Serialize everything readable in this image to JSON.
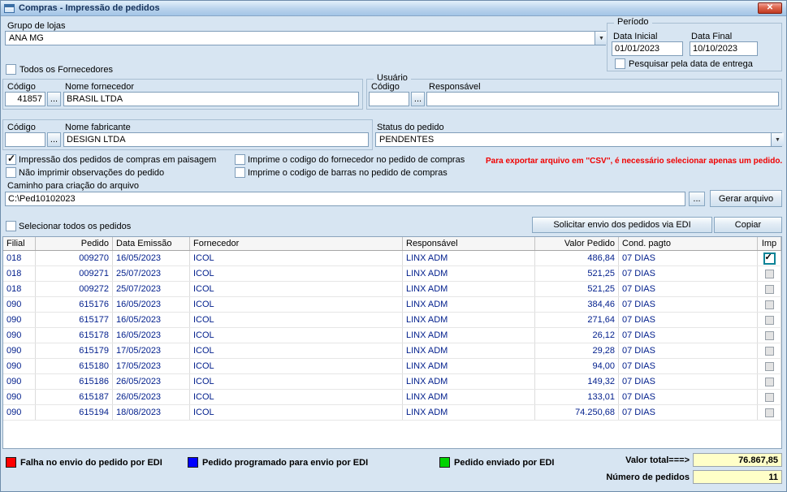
{
  "window": {
    "title": "Compras - Impressão de pedidos"
  },
  "icons": {
    "close": "✕",
    "dropdown": "▼"
  },
  "ui": {
    "browse_label": "..."
  },
  "top": {
    "grupo_lojas_label": "Grupo de lojas",
    "grupo_lojas_value": "ANA MG"
  },
  "periodo": {
    "title": "Período",
    "data_inicial_label": "Data Inicial",
    "data_inicial_value": "01/01/2023",
    "data_final_label": "Data Final",
    "data_final_value": "10/10/2023"
  },
  "checkboxes": {
    "pesquisar_entrega": {
      "label": "Pesquisar pela data de entrega",
      "checked": false
    },
    "todos_fornecedores": {
      "label": "Todos os Fornecedores",
      "checked": false
    },
    "paisagem": {
      "label": "Impressão dos pedidos de compras em paisagem",
      "checked": true
    },
    "nao_imprimir_obs": {
      "label": "Não imprimir observações do pedido",
      "checked": false
    },
    "imprime_cod_fornecedor": {
      "label": "Imprime o codigo do fornecedor no pedido de compras",
      "checked": false
    },
    "imprime_cod_barras": {
      "label": "Imprime o codigo de barras no pedido de compras",
      "checked": false
    },
    "selecionar_todos": {
      "label": "Selecionar todos os pedidos",
      "checked": false
    }
  },
  "fornecedor": {
    "codigo_label": "Código",
    "codigo_value": "41857",
    "nome_label": "Nome fornecedor",
    "nome_value": "BRASIL LTDA"
  },
  "usuario": {
    "title": "Usuário",
    "codigo_label": "Código",
    "codigo_value": "",
    "responsavel_label": "Responsável",
    "responsavel_value": ""
  },
  "fabricante": {
    "codigo_label": "Código",
    "codigo_value": "",
    "nome_label": "Nome fabricante",
    "nome_value": "DESIGN LTDA"
  },
  "status": {
    "label": "Status do pedido",
    "value": "PENDENTES"
  },
  "warning": "Para exportar arquivo em ''CSV'', é necessário selecionar apenas um pedido.",
  "arquivo": {
    "label": "Caminho para criação do arquivo",
    "path_value": "C:\\Ped10102023",
    "gerar_button": "Gerar arquivo"
  },
  "actions": {
    "edi_button": "Solicitar envio dos pedidos via EDI",
    "copiar_button": "Copiar"
  },
  "table": {
    "headers": [
      "Filial",
      "Pedido",
      "Data Emissão",
      "Fornecedor",
      "Responsável",
      "Valor Pedido",
      "Cond. pagto",
      "Imp"
    ],
    "rows": [
      {
        "filial": "018",
        "pedido": "009270",
        "data": "16/05/2023",
        "fornecedor": "ICOL",
        "responsavel": "LINX ADM",
        "valor": "486,84",
        "cond": "07 DIAS",
        "imp": true
      },
      {
        "filial": "018",
        "pedido": "009271",
        "data": "25/07/2023",
        "fornecedor": "ICOL",
        "responsavel": "LINX ADM",
        "valor": "521,25",
        "cond": "07 DIAS",
        "imp": false
      },
      {
        "filial": "018",
        "pedido": "009272",
        "data": "25/07/2023",
        "fornecedor": "ICOL",
        "responsavel": "LINX ADM",
        "valor": "521,25",
        "cond": "07 DIAS",
        "imp": false
      },
      {
        "filial": "090",
        "pedido": "615176",
        "data": "16/05/2023",
        "fornecedor": "ICOL",
        "responsavel": "LINX ADM",
        "valor": "384,46",
        "cond": "07 DIAS",
        "imp": false
      },
      {
        "filial": "090",
        "pedido": "615177",
        "data": "16/05/2023",
        "fornecedor": "ICOL",
        "responsavel": "LINX ADM",
        "valor": "271,64",
        "cond": "07 DIAS",
        "imp": false
      },
      {
        "filial": "090",
        "pedido": "615178",
        "data": "16/05/2023",
        "fornecedor": "ICOL",
        "responsavel": "LINX ADM",
        "valor": "26,12",
        "cond": "07 DIAS",
        "imp": false
      },
      {
        "filial": "090",
        "pedido": "615179",
        "data": "17/05/2023",
        "fornecedor": "ICOL",
        "responsavel": "LINX ADM",
        "valor": "29,28",
        "cond": "07 DIAS",
        "imp": false
      },
      {
        "filial": "090",
        "pedido": "615180",
        "data": "17/05/2023",
        "fornecedor": "ICOL",
        "responsavel": "LINX ADM",
        "valor": "94,00",
        "cond": "07 DIAS",
        "imp": false
      },
      {
        "filial": "090",
        "pedido": "615186",
        "data": "26/05/2023",
        "fornecedor": "ICOL",
        "responsavel": "LINX ADM",
        "valor": "149,32",
        "cond": "07 DIAS",
        "imp": false
      },
      {
        "filial": "090",
        "pedido": "615187",
        "data": "26/05/2023",
        "fornecedor": "ICOL",
        "responsavel": "LINX ADM",
        "valor": "133,01",
        "cond": "07 DIAS",
        "imp": false
      },
      {
        "filial": "090",
        "pedido": "615194",
        "data": "18/08/2023",
        "fornecedor": "ICOL",
        "responsavel": "LINX ADM",
        "valor": "74.250,68",
        "cond": "07 DIAS",
        "imp": false
      }
    ]
  },
  "legend": [
    {
      "color": "#ff0000",
      "label": "Falha no envio do pedido por EDI"
    },
    {
      "color": "#0000ff",
      "label": "Pedido programado para envio por EDI"
    },
    {
      "color": "#00d400",
      "label": "Pedido enviado por EDI"
    }
  ],
  "totals": {
    "valor_label": "Valor total===>",
    "valor_value": "76.867,85",
    "numero_label": "Número de pedidos",
    "numero_value": "11"
  }
}
